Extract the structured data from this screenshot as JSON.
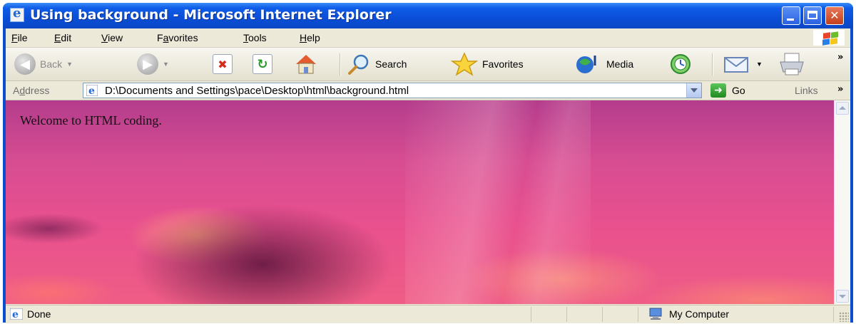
{
  "window": {
    "title": "Using background - Microsoft Internet Explorer"
  },
  "menubar": {
    "items": [
      {
        "acc": "F",
        "rest": "ile"
      },
      {
        "acc": "E",
        "rest": "dit"
      },
      {
        "acc": "V",
        "rest": "iew"
      },
      {
        "pre": "F",
        "acc": "a",
        "rest": "vorites"
      },
      {
        "acc": "T",
        "rest": "ools"
      },
      {
        "acc": "H",
        "rest": "elp"
      }
    ]
  },
  "toolbar": {
    "back": "Back",
    "search": "Search",
    "favorites": "Favorites",
    "media": "Media"
  },
  "address": {
    "label_pre": "A",
    "label_acc": "d",
    "label_rest": "dress",
    "url": "D:\\Documents and Settings\\pace\\Desktop\\html\\background.html",
    "go": "Go",
    "links": "Links"
  },
  "page": {
    "text": "Welcome to HTML coding."
  },
  "status": {
    "left": "Done",
    "zone": "My Computer"
  }
}
